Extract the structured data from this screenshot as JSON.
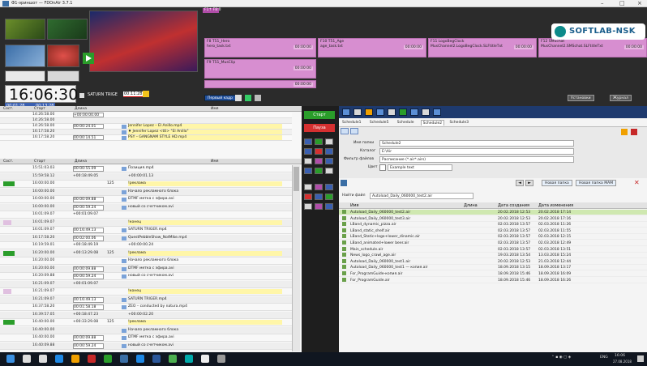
{
  "window": {
    "title": "Ф1-эриншот — FDOnAir 3.7.1",
    "controls": [
      "–",
      "□",
      "×"
    ]
  },
  "logo": {
    "text": "SOFTLAB-NSK"
  },
  "clock": {
    "time": "16:06:30",
    "sub1": "00:01:28",
    "sub2": "00:13:28"
  },
  "saturn_label": "SATURN TRIGE",
  "saturn_tc": "00:11:28",
  "top_small_label": "F1↑ F8:0",
  "lanes": [
    {
      "name": "F8 T51_Hero",
      "media": "hero_task.txt",
      "tc": "00:00:00"
    },
    {
      "name": "F10 T51_Age",
      "media": "age_task.txt",
      "tc": "00:00:00"
    },
    {
      "name": "F11 LogoBegClock",
      "media": "MusChannel2.LogoBegClock.SLFtitleTxt",
      "tc": "00:00:00"
    },
    {
      "name": "F12 SMSchat",
      "media": "MusChannel2.SMSchat.SLFtitleTxt",
      "tc": "00:00:00"
    }
  ],
  "lane_row2": {
    "name": "F9 T51_MusClip",
    "tc": "00:00:00"
  },
  "lane_row3_tc": "00:00:00",
  "toolbar": {
    "first_frame": "Первый кадр",
    "start": "Старт",
    "pause": "Пауза",
    "right_a": "Установки",
    "right_b": "Журнал"
  },
  "pl_headers": [
    "Сост.",
    "Старт",
    "Длина",
    "Имя"
  ],
  "pl_top_rows": [
    {
      "start": "14:26:58.00",
      "len": "+00:00:00.00",
      "dur": "",
      "name": ""
    },
    {
      "start": "14:26:58.00",
      "len": "",
      "dur": "",
      "name": ""
    },
    {
      "start": "14:26:58.00",
      "len": "00:00:24.01",
      "dur": "",
      "name": "Jennifer Lopez – El Anillo.mp4"
    },
    {
      "start": "16:17:58.20",
      "len": "",
      "dur": "",
      "name": "♦ Jennifer Lopez <ttl> \"El Anillo\""
    },
    {
      "start": "16:17:58.20",
      "len": "00:00:14.51",
      "dur": "",
      "name": "PSY – GANGNAM STYLE HD.mp4"
    }
  ],
  "pl_rows": [
    {
      "start": "15:51:03.03",
      "len": "00:00:55.09",
      "dur": "",
      "name": "Позиция.mp4"
    },
    {
      "start": "15:59:58.12",
      "len": "+00:18:49.05",
      "dur": "",
      "name": "+00:00:01.13"
    },
    {
      "start": "16:00:00.00",
      "len": "",
      "dur": "125",
      "name": "!реклама"
    },
    {
      "start": "16:00:00.00",
      "len": "",
      "dur": "",
      "name": "Начало рекламного блока"
    },
    {
      "start": "16:00:00.00",
      "len": "00:00:09.88",
      "dur": "",
      "name": "DTMF метка с эфира.avi"
    },
    {
      "start": "16:00:00.00",
      "len": "00:00:59.24",
      "dur": "",
      "name": "новый со счетчиком.avi"
    },
    {
      "start": "16:01:09.07",
      "len": "+00:01:09.07",
      "dur": "",
      "name": ""
    },
    {
      "start": "16:01:09.07",
      "len": "",
      "dur": "",
      "name": "!конец"
    },
    {
      "start": "16:01:09.07",
      "len": "00:16:49.13",
      "dur": "",
      "name": "SATURN TRIGER.mp4"
    },
    {
      "start": "16:17:58.20",
      "len": "00:02:00.06",
      "dur": "",
      "name": "QuestPebbleShow_NotMike.mp4"
    },
    {
      "start": "16:19:59.01",
      "len": "+00:18:49.19",
      "dur": "",
      "name": "+00:00:00.24"
    },
    {
      "start": "16:20:00.00",
      "len": "+00:13:29.08",
      "dur": "125",
      "name": "!реклама"
    },
    {
      "start": "16:20:00.00",
      "len": "",
      "dur": "",
      "name": "Начало рекламного блока"
    },
    {
      "start": "16:20:00.00",
      "len": "00:00:09.88",
      "dur": "",
      "name": "DTMF метка с эфира.avi"
    },
    {
      "start": "16:20:09.88",
      "len": "00:00:59.24",
      "dur": "",
      "name": "новый со счетчиком.avi"
    },
    {
      "start": "16:21:09.07",
      "len": "+00:01:09.07",
      "dur": "",
      "name": ""
    },
    {
      "start": "16:21:09.07",
      "len": "",
      "dur": "",
      "name": "!конец"
    },
    {
      "start": "16:21:09.07",
      "len": "00:16:49.13",
      "dur": "",
      "name": "SATURN TRIGER.mp4"
    },
    {
      "start": "16:37:58.20",
      "len": "00:01:58.18",
      "dur": "",
      "name": "ZEO – conducted by natura.mp4"
    },
    {
      "start": "16:39:57.05",
      "len": "+00:18:47.23",
      "dur": "",
      "name": "+00:00:02.20"
    },
    {
      "start": "16:40:00.00",
      "len": "+00:33:29.08",
      "dur": "125",
      "name": "!реклама"
    },
    {
      "start": "16:40:00.00",
      "len": "",
      "dur": "",
      "name": "Начало рекламного блока"
    },
    {
      "start": "16:40:00.00",
      "len": "00:00:09.88",
      "dur": "",
      "name": "DTMF метка с эфира.avi"
    },
    {
      "start": "16:40:09.88",
      "len": "00:00:59.24",
      "dur": "",
      "name": "новый со счетчиком.avi"
    }
  ],
  "schedule_tabs": [
    "Schedule1",
    "Schedule5",
    "Schedule",
    "Schedule2",
    "Schedule3"
  ],
  "form": {
    "name_label": "Имя папки",
    "name_value": "Schedule2",
    "catalog_label": "Каталог",
    "catalog_value": "E:\\Air",
    "filter_label": "Фильтр файлов",
    "filter_value": "Расписание (*.air*.airs)",
    "color_label": "Цвет",
    "color_value": "Example text",
    "new_folder": "Новая папка",
    "new_folder_mam": "Новая папка МАМ"
  },
  "find": {
    "label": "Найти файл",
    "value": "Autoload_Daily_060000_test2.air"
  },
  "file_headers": [
    "Имя",
    "Длина",
    "Дата создания",
    "Дата изменения"
  ],
  "files": [
    {
      "name": "Autoload_Daily_060000_test2.air",
      "created": "20.02.2018 12:53",
      "modified": "20.02.2018 17:14"
    },
    {
      "name": "Autoload_Daily_060000_test3.air",
      "created": "20.02.2018 12:53",
      "modified": "20.02.2018 17:16"
    },
    {
      "name": "LBand_dynamic_pizza.air",
      "created": "02.03.2018 13:57",
      "modified": "02.03.2018 11:26"
    },
    {
      "name": "LBand_static_shelf.air",
      "created": "02.03.2018 13:57",
      "modified": "02.03.2018 11:55"
    },
    {
      "name": "LBand_Static+logo+lower_dinamic.air",
      "created": "02.03.2018 13:57",
      "modified": "02.03.2018 12:15"
    },
    {
      "name": "LBand_animated+lower beer.air",
      "created": "02.03.2018 13:57",
      "modified": "02.03.2018 12:49"
    },
    {
      "name": "Main_schedule.air",
      "created": "02.03.2018 13:57",
      "modified": "02.03.2018 13:51"
    },
    {
      "name": "News_logo_crawl_age.air",
      "created": "19.03.2018 13:54",
      "modified": "13.03.2018 15:24"
    },
    {
      "name": "Autoload_Daily_060000_test1.air",
      "created": "20.02.2018 12:53",
      "modified": "21.03.2018 12:44"
    },
    {
      "name": "Autoload_Daily_060000_test1 — копия.air",
      "created": "18.09.2018 13:15",
      "modified": "18.09.2018 13:17"
    },
    {
      "name": "For_ProgramGuide-копия.air",
      "created": "18.09.2018 15:46",
      "modified": "18.09.2018 16:09"
    },
    {
      "name": "For_ProgramGuide.air",
      "created": "18.09.2018 15:46",
      "modified": "18.09.2018 16:26"
    }
  ],
  "tray": {
    "lang": "ENG",
    "time": "16:06",
    "date": "27.08.2018"
  },
  "colors": {
    "accent_pink": "#d78ed0",
    "selection_green": "#cfe8b0",
    "clip_yellow": "#fff6a8",
    "green_btn": "#2a9d2a",
    "red_btn": "#c62828"
  }
}
